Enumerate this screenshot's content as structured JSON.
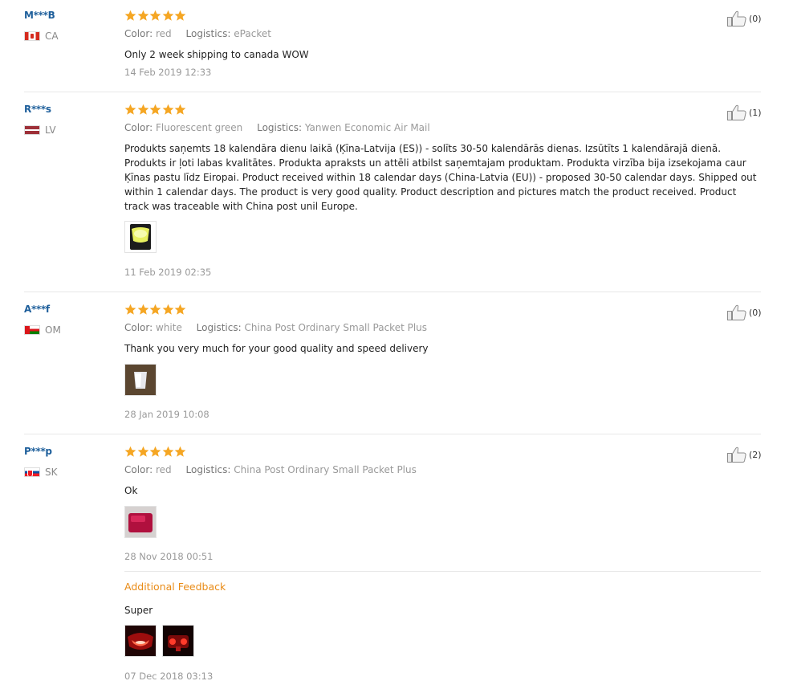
{
  "reviews": [
    {
      "user": "M***B",
      "country": "CA",
      "flag": "ca",
      "rating": 5,
      "color_label": "Color:",
      "color_value": "red",
      "logistics_label": "Logistics:",
      "logistics_value": "ePacket",
      "text": "Only 2 week shipping to canada WOW",
      "date": "14 Feb 2019 12:33",
      "helpful": "(0)"
    },
    {
      "user": "R***s",
      "country": "LV",
      "flag": "lv",
      "rating": 5,
      "color_label": "Color:",
      "color_value": "Fluorescent green",
      "logistics_label": "Logistics:",
      "logistics_value": "Yanwen Economic Air Mail",
      "text": "Produkts saņemts 18 kalendāra dienu laikā (Ķīna-Latvija (ES)) - solīts 30-50 kalendārās dienas. Izsūtīts 1 kalendārajā dienā. Produkts ir ļoti labas kvalitātes. Produkta apraksts un attēli atbilst saņemtajam produktam. Produkta virzība bija izsekojama caur Ķīnas pastu līdz Eiropai. Product received within 18 calendar days (China-Latvia (EU)) - proposed 30-50 calendar days. Shipped out within 1 calendar days. The product is very good quality. Product description and pictures match the product received. Product track was traceable with China post unil Europe.",
      "date": "11 Feb 2019 02:35",
      "helpful": "(1)"
    },
    {
      "user": "A***f",
      "country": "OM",
      "flag": "om",
      "rating": 5,
      "color_label": "Color:",
      "color_value": "white",
      "logistics_label": "Logistics:",
      "logistics_value": "China Post Ordinary Small Packet Plus",
      "text": "Thank you very much for your good quality and speed delivery",
      "date": "28 Jan 2019 10:08",
      "helpful": "(0)"
    },
    {
      "user": "P***p",
      "country": "SK",
      "flag": "sk",
      "rating": 5,
      "color_label": "Color:",
      "color_value": "red",
      "logistics_label": "Logistics:",
      "logistics_value": "China Post Ordinary Small Packet Plus",
      "text": "Ok",
      "date": "28 Nov 2018 00:51",
      "helpful": "(2)",
      "additional": {
        "title": "Additional Feedback",
        "text": "Super",
        "date": "07 Dec 2018 03:13"
      }
    }
  ],
  "colors": {
    "star": "#f5a623",
    "username": "#1e5f9b",
    "additional_title": "#e98b16"
  },
  "icons": {
    "helpful": "thumbs-up-icon",
    "star": "star-icon"
  }
}
